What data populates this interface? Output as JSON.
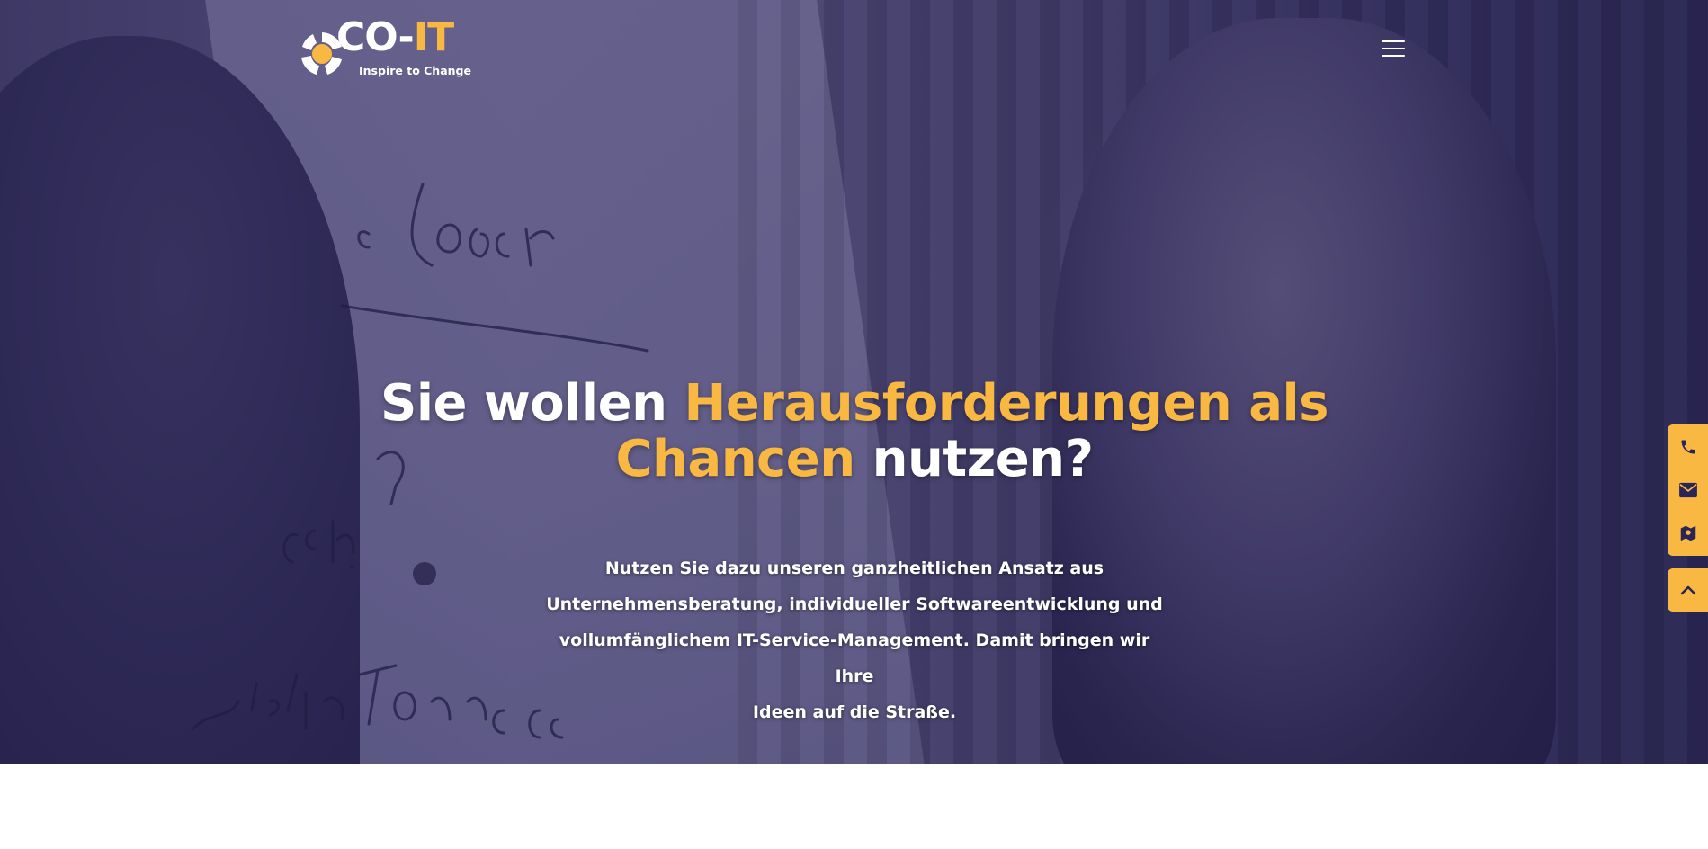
{
  "brand": {
    "name_part1": "CO-",
    "name_part2": "IT",
    "tagline": "Inspire to Change",
    "accent_color": "#f9b841",
    "dark_color": "#2a2458"
  },
  "header": {
    "menu_icon": "hamburger-menu-icon"
  },
  "hero": {
    "headline_part1": "Sie wollen ",
    "headline_highlight1": "Herausforderungen als",
    "headline_highlight2": "Chancen",
    "headline_part2": " nutzen?",
    "lead_line1": "Nutzen Sie dazu unseren ganzheitlichen Ansatz aus",
    "lead_line2": "Unternehmensberatung, individueller Softwareentwicklung und",
    "lead_line3": "vollumfänglichem IT-Service-Management. Damit bringen wir Ihre",
    "lead_line4": "Ideen auf die Straße."
  },
  "contact_bar": {
    "icons": [
      "phone-icon",
      "mail-icon",
      "map-icon"
    ],
    "scroll_top_icon": "chevron-up-icon"
  }
}
